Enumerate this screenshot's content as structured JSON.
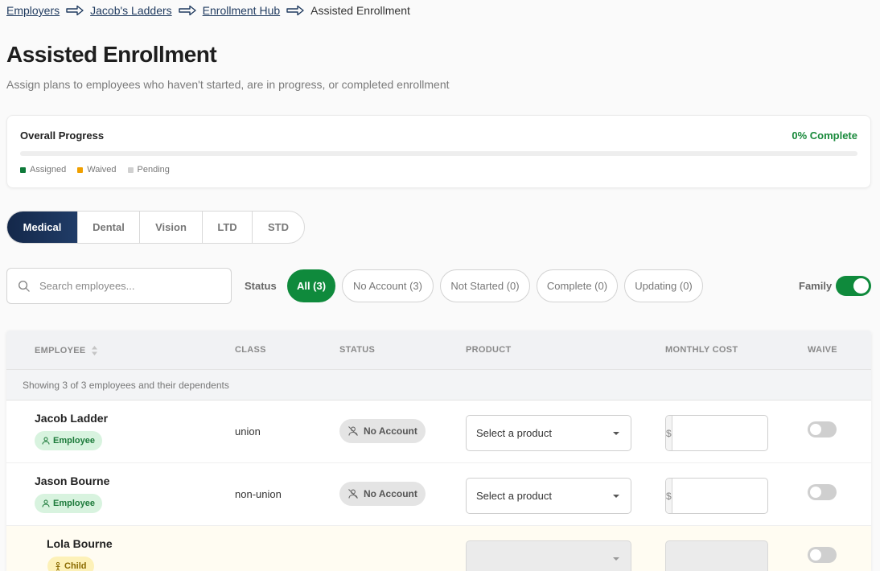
{
  "breadcrumb": {
    "items": [
      "Employers",
      "Jacob's Ladders",
      "Enrollment Hub"
    ],
    "current": "Assisted Enrollment"
  },
  "page": {
    "title": "Assisted Enrollment",
    "subtitle": "Assign plans to employees who haven't started, are in progress, or completed enrollment"
  },
  "progress": {
    "title": "Overall Progress",
    "percent_label": "0% Complete",
    "value": 0,
    "legend": [
      {
        "label": "Assigned",
        "color": "#0f7a3a"
      },
      {
        "label": "Waived",
        "color": "#f0a000"
      },
      {
        "label": "Pending",
        "color": "#d0d0d0"
      }
    ]
  },
  "tabs": [
    {
      "label": "Medical",
      "active": true
    },
    {
      "label": "Dental",
      "active": false
    },
    {
      "label": "Vision",
      "active": false
    },
    {
      "label": "LTD",
      "active": false
    },
    {
      "label": "STD",
      "active": false
    }
  ],
  "filters": {
    "search_placeholder": "Search employees...",
    "status_label": "Status",
    "chips": [
      {
        "label": "All (3)",
        "active": true
      },
      {
        "label": "No Account (3)",
        "active": false
      },
      {
        "label": "Not Started (0)",
        "active": false
      },
      {
        "label": "Complete (0)",
        "active": false
      },
      {
        "label": "Updating (0)",
        "active": false
      }
    ],
    "family_label": "Family",
    "family_on": true
  },
  "table": {
    "columns": [
      "EMPLOYEE",
      "CLASS",
      "STATUS",
      "PRODUCT",
      "MONTHLY COST",
      "WAIVE"
    ],
    "showing_text": "Showing 3 of 3 employees and their dependents",
    "currency_symbol": "$",
    "rows": [
      {
        "name": "Jacob Ladder",
        "role": "Employee",
        "class": "union",
        "status": "No Account",
        "product": "Select a product",
        "dependent": false
      },
      {
        "name": "Jason Bourne",
        "role": "Employee",
        "class": "non-union",
        "status": "No Account",
        "product": "Select a product",
        "dependent": false
      },
      {
        "name": "Lola Bourne",
        "role": "Child",
        "class": "",
        "status": "",
        "product": "",
        "dependent": true
      }
    ]
  },
  "colors": {
    "accent_green": "#0f8a3c",
    "nav_dark": "#14284a",
    "link": "#1f3a5f"
  }
}
